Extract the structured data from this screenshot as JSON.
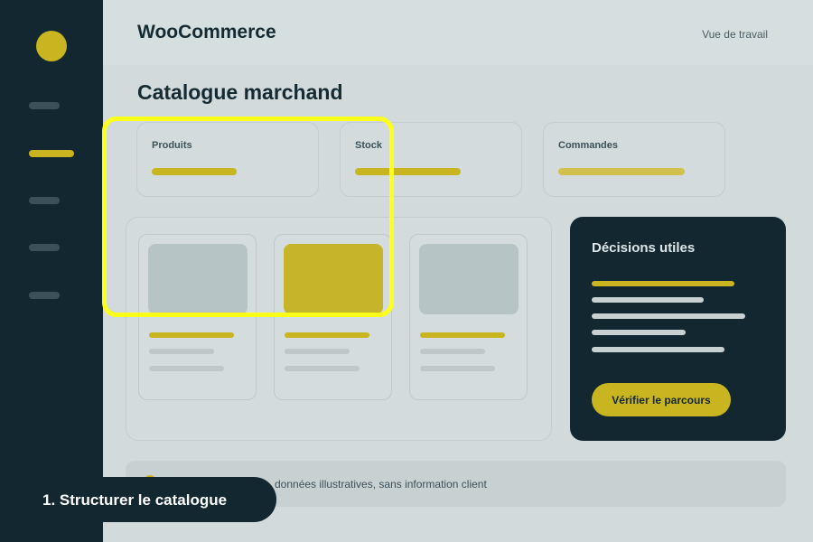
{
  "header": {
    "brand": "WooCommerce",
    "link": "Vue de travail"
  },
  "sidebar": {
    "items": [
      {
        "name": "nav-1",
        "active": false
      },
      {
        "name": "nav-2",
        "active": true
      },
      {
        "name": "nav-3",
        "active": false
      },
      {
        "name": "nav-4",
        "active": false
      },
      {
        "name": "nav-5",
        "active": false
      }
    ]
  },
  "main": {
    "title": "Catalogue marchand",
    "stats": [
      {
        "label": "Produits"
      },
      {
        "label": "Stock"
      },
      {
        "label": "Commandes"
      }
    ]
  },
  "decisions": {
    "title": "Décisions utiles",
    "button_label": "Vérifier le parcours"
  },
  "notice": {
    "text": "données illustratives, sans information client"
  },
  "step": {
    "label": "1. Structurer le catalogue"
  },
  "colors": {
    "accent": "#c9b51f",
    "dark": "#12272f",
    "background": "#d2dadb",
    "highlight": "#ffff1a"
  }
}
